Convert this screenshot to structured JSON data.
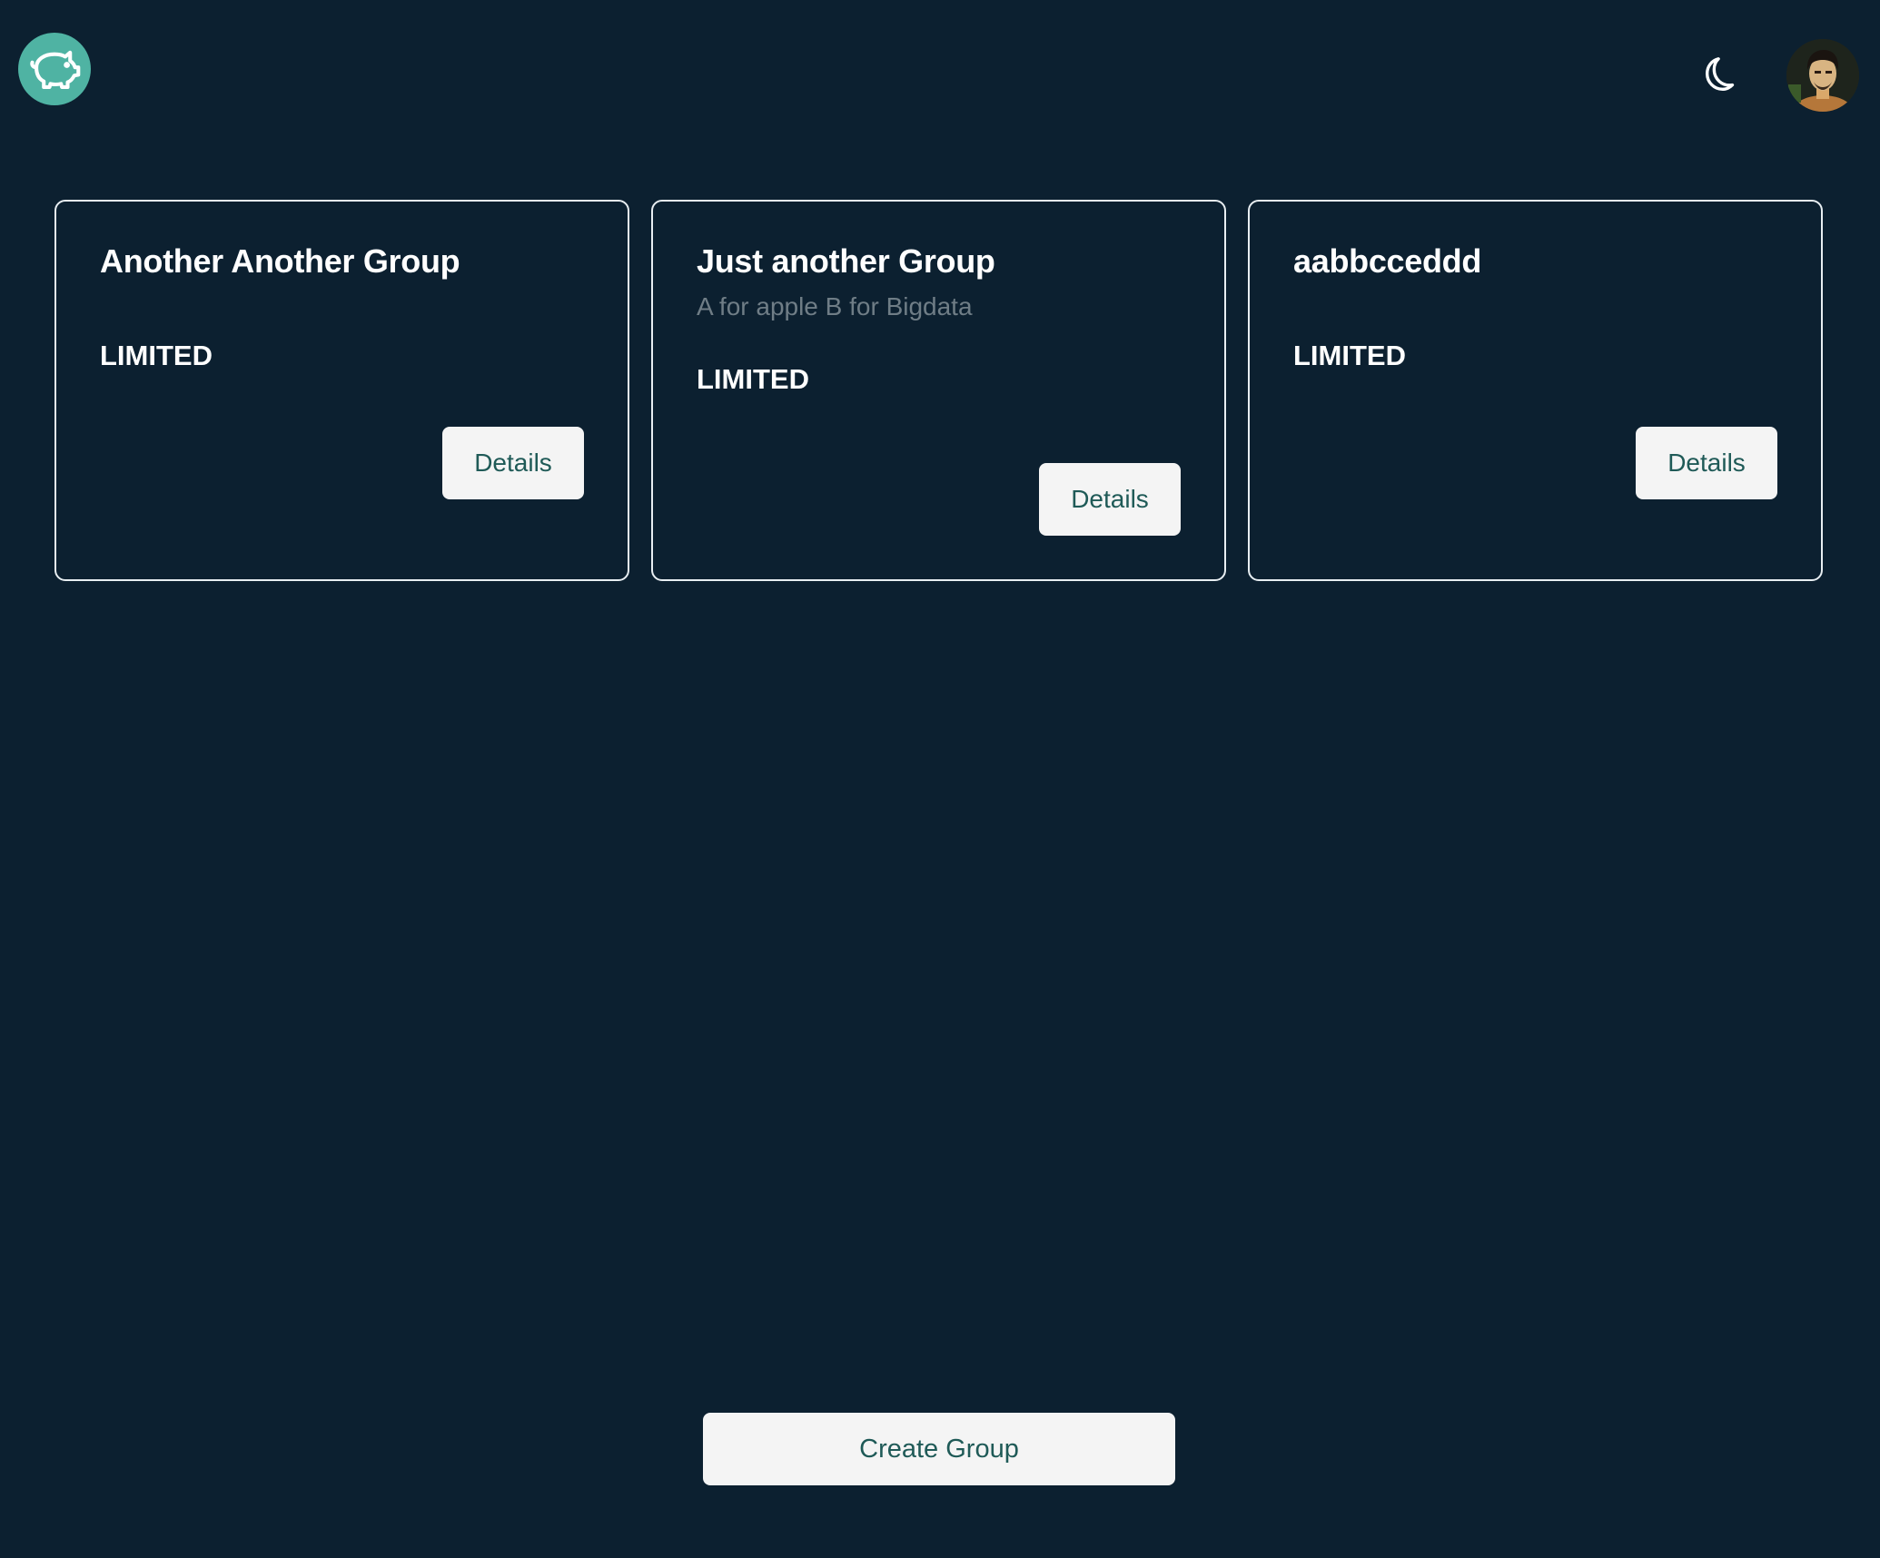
{
  "header": {
    "logo_icon": "piggy-bank-icon",
    "theme_icon": "moon-icon",
    "avatar_icon": "user-avatar"
  },
  "groups": [
    {
      "title": "Another Another Group",
      "subtitle": "",
      "status": "LIMITED",
      "button_label": "Details"
    },
    {
      "title": "Just another Group",
      "subtitle": "A for apple B for Bigdata",
      "status": "LIMITED",
      "button_label": "Details"
    },
    {
      "title": "aabbcceddd",
      "subtitle": "",
      "status": "LIMITED",
      "button_label": "Details"
    }
  ],
  "actions": {
    "create_label": "Create Group"
  },
  "colors": {
    "background": "#0c2030",
    "logo_bg": "#4fb3a3",
    "button_bg": "#f4f4f4",
    "button_text": "#1f5a57",
    "subtitle_text": "#6f7d86"
  }
}
